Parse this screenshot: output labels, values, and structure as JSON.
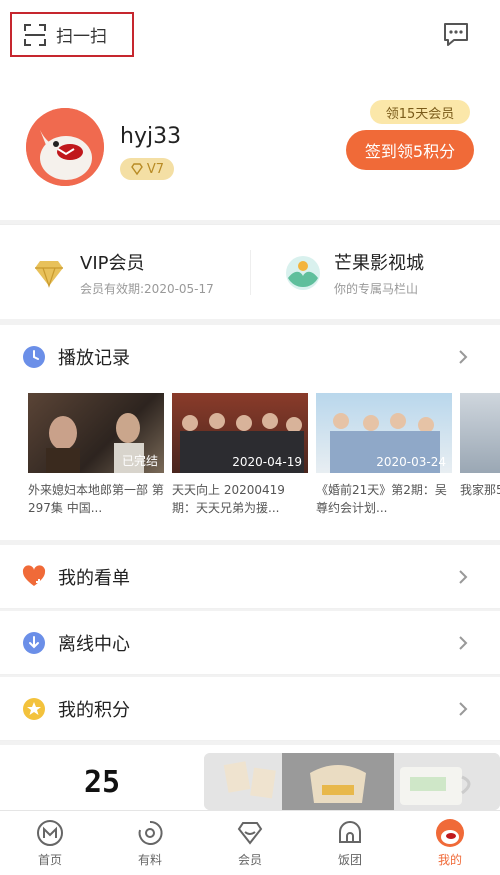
{
  "header": {
    "scan_label": "扫一扫"
  },
  "profile": {
    "username": "hyj33",
    "level": "V7",
    "promo_tip": "领15天会员",
    "checkin_label": "签到领5积分"
  },
  "membership": {
    "vip_title": "VIP会员",
    "vip_sub": "会员有效期:2020-05-17",
    "mall_title": "芒果影视城",
    "mall_sub": "你的专属马栏山"
  },
  "history": {
    "title": "播放记录",
    "items": [
      {
        "overlay": "已完结",
        "caption": "外来媳妇本地郎第一部 第297集 中国..."
      },
      {
        "overlay": "2020-04-19",
        "caption": "天天向上 20200419期：天天兄弟为援..."
      },
      {
        "overlay": "2020-03-24",
        "caption": "《婚前21天》第2期：吴尊约会计划..."
      },
      {
        "overlay": "",
        "caption": "我家那5期："
      }
    ]
  },
  "rows": {
    "watchlist": "我的看单",
    "offline": "离线中心",
    "points": "我的积分"
  },
  "page_number": "25",
  "tabs": [
    "首页",
    "有料",
    "会员",
    "饭团",
    "我的"
  ],
  "colors": {
    "accent": "#f06a38",
    "gold": "#f4dfa4",
    "highlight_border": "#c6262e"
  }
}
